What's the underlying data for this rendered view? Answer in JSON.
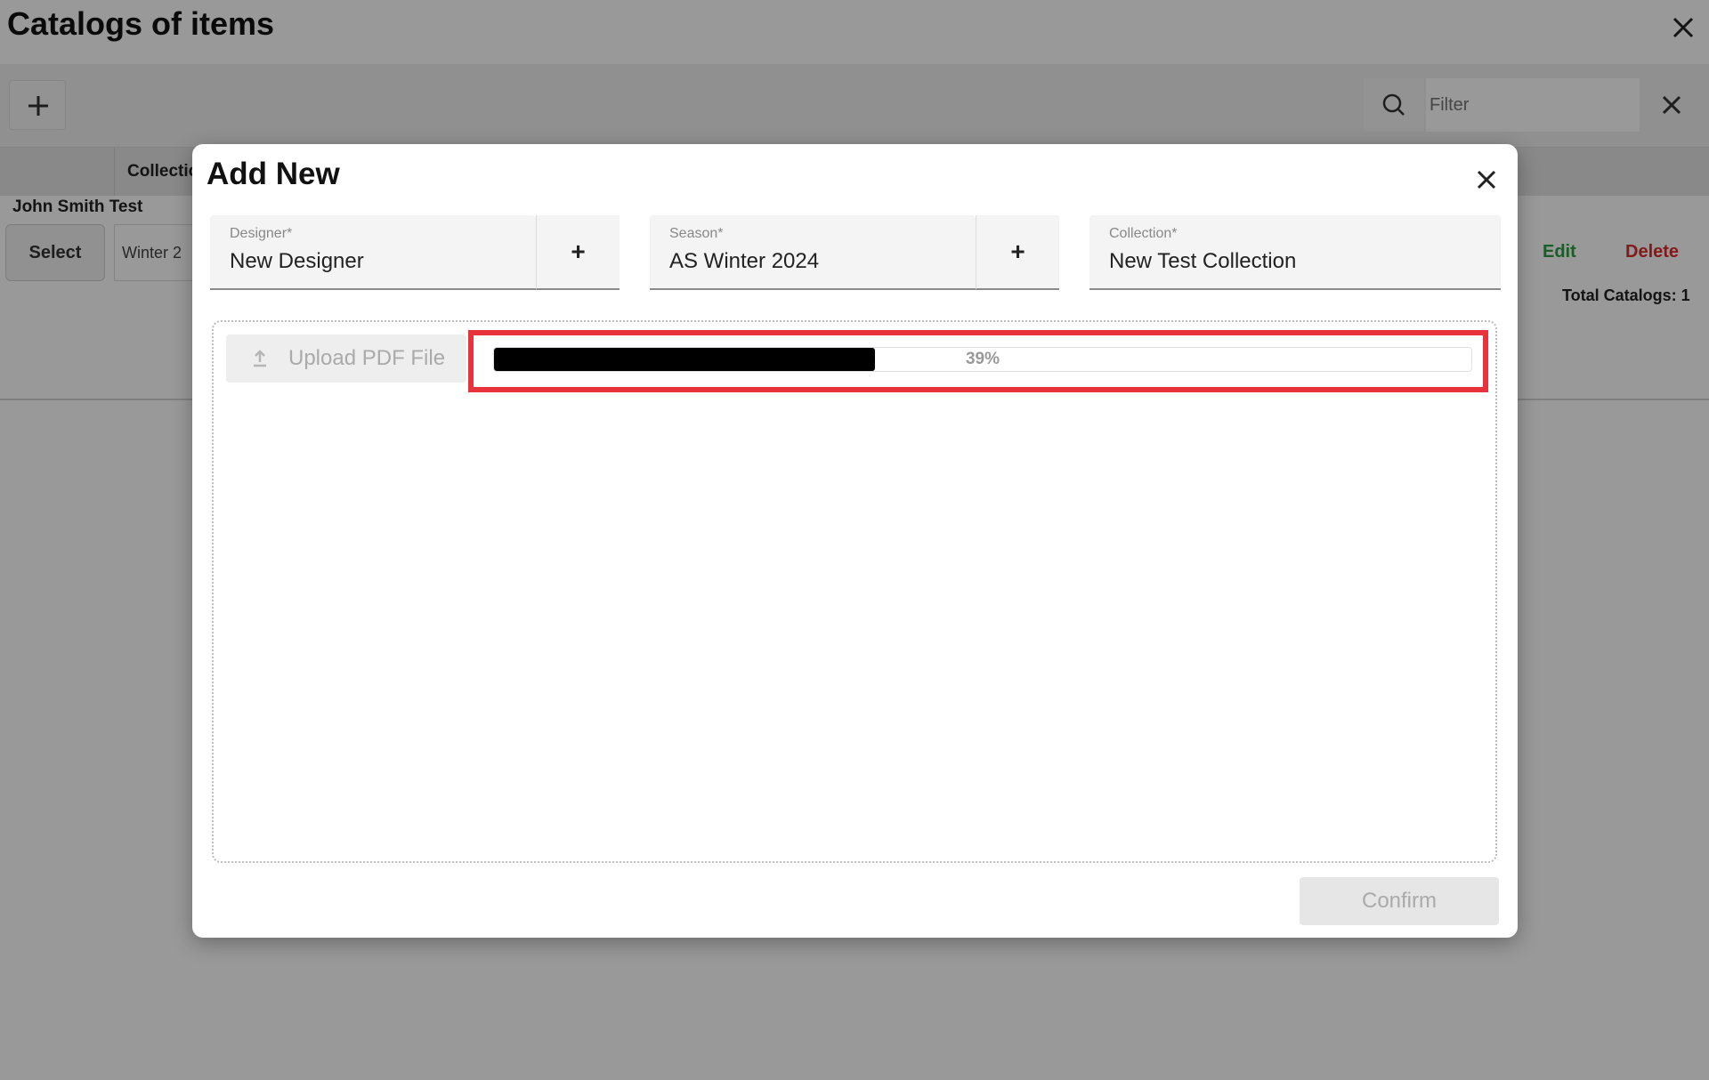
{
  "background_page": {
    "title": "Catalogs of items",
    "filter_placeholder": "Filter",
    "table_header": "Collectio",
    "row_group": "John Smith Test",
    "select_label": "Select",
    "row_cell": "Winter 2",
    "edit_label": "Edit",
    "delete_label": "Delete",
    "total_label": "Total Catalogs: 1"
  },
  "modal": {
    "title": "Add New",
    "fields": {
      "designer": {
        "label": "Designer*",
        "value": "New Designer"
      },
      "season": {
        "label": "Season*",
        "value": "AS Winter 2024"
      },
      "collection": {
        "label": "Collection*",
        "value": "New Test Collection"
      }
    },
    "add_symbol": "+",
    "upload_label": "Upload PDF File",
    "progress": {
      "value": 0.39,
      "label": "39%"
    },
    "confirm_label": "Confirm"
  },
  "colors": {
    "highlight": "#e8323c",
    "edit": "#2e9a45",
    "delete": "#d62d2d",
    "progress_fill": "#000000"
  },
  "icons": [
    "close-icon",
    "plus-icon",
    "search-icon",
    "upload-icon"
  ]
}
